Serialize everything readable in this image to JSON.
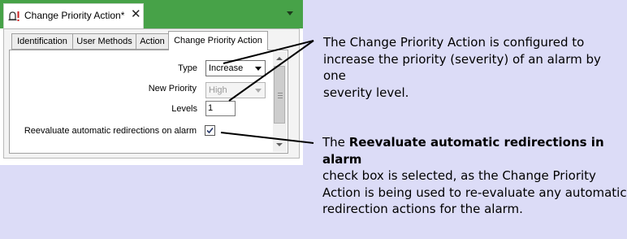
{
  "window": {
    "tab_title": "Change Priority Action*",
    "close_glyph": "✕",
    "alarm_icon": "alarm-bell-icon"
  },
  "tabs": [
    {
      "label": "Identification",
      "active": false
    },
    {
      "label": "User Methods",
      "active": false
    },
    {
      "label": "Action",
      "active": false
    },
    {
      "label": "Change Priority Action",
      "active": true
    }
  ],
  "form": {
    "type": {
      "label": "Type",
      "value": "Increase"
    },
    "new_priority": {
      "label": "New Priority",
      "value": "High",
      "disabled": true
    },
    "levels": {
      "label": "Levels",
      "value": "1"
    },
    "reevaluate": {
      "label": "Reevaluate automatic redirections on alarm",
      "checked": true
    }
  },
  "callouts": {
    "first": {
      "line1": "The Change Priority Action is configured to",
      "line2": "increase the priority (severity) of an alarm by one",
      "line3": "severity level."
    },
    "second": {
      "line1_prefix": "The",
      "line1_bold": "Reevaluate automatic redirections in alarm",
      "line2": "check box is selected, as the Change Priority",
      "line3": "Action is being used to re-evaluate any automatic",
      "line4": "redirection actions for the alarm."
    }
  },
  "colors": {
    "titlebar": "#47a248",
    "background": "#dcdcf7",
    "alarm_icon_red": "#cc1f1f"
  }
}
